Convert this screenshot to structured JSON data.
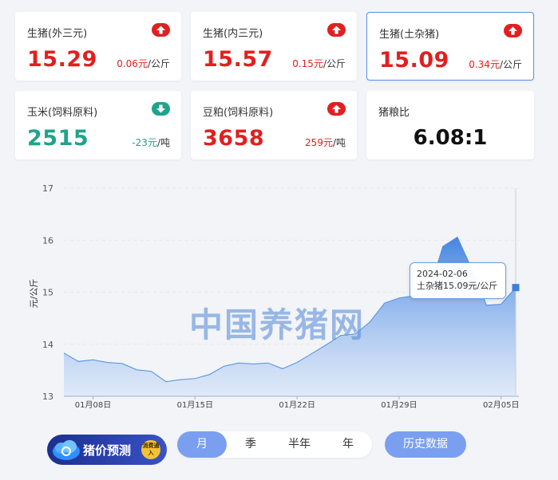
{
  "cards": [
    {
      "name": "生猪(外三元)",
      "value": "15.29",
      "change": "0.06元",
      "unit": "/公斤",
      "trend": "up"
    },
    {
      "name": "生猪(内三元)",
      "value": "15.57",
      "change": "0.15元",
      "unit": "/公斤",
      "trend": "up"
    },
    {
      "name": "生猪(土杂猪)",
      "value": "15.09",
      "change": "0.34元",
      "unit": "/公斤",
      "trend": "up",
      "selected": true
    },
    {
      "name": "玉米(饲料原料)",
      "value": "2515",
      "change": "-23元",
      "unit": "/吨",
      "trend": "down"
    },
    {
      "name": "豆粕(饲料原料)",
      "value": "3658",
      "change": "259元",
      "unit": "/吨",
      "trend": "up"
    },
    {
      "name": "猪粮比",
      "value": "6.08:1"
    }
  ],
  "colors": {
    "up": "#e02020",
    "down": "#1fa48a",
    "accent": "#7b9ff0",
    "line": "#4f8ee0"
  },
  "icons": {
    "up": "arrow-up-icon",
    "down": "arrow-down-icon"
  },
  "chart_data": {
    "type": "area",
    "ylabel": "元/公斤",
    "ylim": [
      13,
      17
    ],
    "yticks": [
      "13",
      "14",
      "15",
      "16",
      "17"
    ],
    "xticks": [
      {
        "label": "01月08日",
        "x": "2024-01-08"
      },
      {
        "label": "01月15日",
        "x": "2024-01-15"
      },
      {
        "label": "01月22日",
        "x": "2024-01-22"
      },
      {
        "label": "01月29日",
        "x": "2024-01-29"
      },
      {
        "label": "02月05日",
        "x": "2024-02-05"
      }
    ],
    "x": [
      "2024-01-06",
      "2024-01-07",
      "2024-01-08",
      "2024-01-09",
      "2024-01-10",
      "2024-01-11",
      "2024-01-12",
      "2024-01-13",
      "2024-01-14",
      "2024-01-15",
      "2024-01-16",
      "2024-01-17",
      "2024-01-18",
      "2024-01-19",
      "2024-01-20",
      "2024-01-21",
      "2024-01-22",
      "2024-01-23",
      "2024-01-24",
      "2024-01-25",
      "2024-01-26",
      "2024-01-27",
      "2024-01-28",
      "2024-01-29",
      "2024-01-30",
      "2024-01-31",
      "2024-02-01",
      "2024-02-02",
      "2024-02-03",
      "2024-02-04",
      "2024-02-05",
      "2024-02-06"
    ],
    "series": [
      {
        "values": [
          13.83,
          13.67,
          13.7,
          13.65,
          13.63,
          13.51,
          13.48,
          13.28,
          13.32,
          13.34,
          13.42,
          13.58,
          13.64,
          13.62,
          13.64,
          13.53,
          13.65,
          13.82,
          13.99,
          14.17,
          14.2,
          14.43,
          14.79,
          14.89,
          14.93,
          14.96,
          15.88,
          16.06,
          15.44,
          14.75,
          14.77,
          15.09
        ]
      }
    ],
    "grid": true,
    "tooltip": {
      "date": "2024-02-06",
      "series": "土杂猪",
      "value": "15.09元/公斤"
    }
  },
  "watermark": "中国养猪网",
  "promo": {
    "label": "猪价预测",
    "tag": "消费通入"
  },
  "periods": [
    {
      "label": "月",
      "active": true
    },
    {
      "label": "季",
      "active": false
    },
    {
      "label": "半年",
      "active": false
    },
    {
      "label": "年",
      "active": false
    }
  ],
  "history_label": "历史数据"
}
